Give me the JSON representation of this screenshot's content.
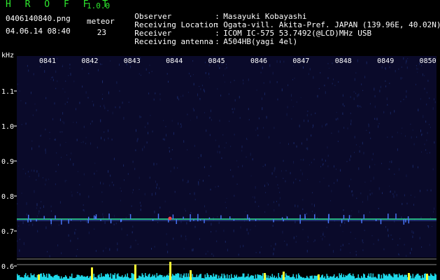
{
  "header": {
    "app_title": "H R O F F T",
    "app_version": "1.0.0",
    "file_name": "0406140840.png",
    "datetime": "04.06.14 08:40",
    "meteor_label": "meteor",
    "meteor_count": "23"
  },
  "info": [
    {
      "label": "Observer",
      "sep": ":",
      "value": "Masayuki Kobayashi"
    },
    {
      "label": "Receiving Location",
      "sep": ":",
      "value": "Ogata-vill. Akita-Pref. JAPAN (139.96E, 40.02N)"
    },
    {
      "label": "Receiver",
      "sep": ":",
      "value": "ICOM IC-575 53.7492(@LCD)MHz USB"
    },
    {
      "label": "Receiving antenna",
      "sep": ":",
      "value": "A504HB(yagi 4el)"
    }
  ],
  "spectrogram": {
    "freq_unit": "kHz",
    "freq_ticks": [
      "1.1",
      "1.0",
      "0.9",
      "0.8",
      "0.7",
      "0.6"
    ],
    "time_ticks": [
      "0841",
      "0842",
      "0843",
      "0844",
      "0845",
      "0846",
      "0847",
      "0848",
      "0849",
      "0850"
    ],
    "colors": {
      "background": "#0a0a2a",
      "noise": "#1a2a6a",
      "carrier": "#2ee89a",
      "echo": "#4a7aff",
      "spectrum_bars": "#1fd8e8",
      "spectrum_peaks": "#ffff33",
      "highlight": "#ff4444"
    }
  }
}
